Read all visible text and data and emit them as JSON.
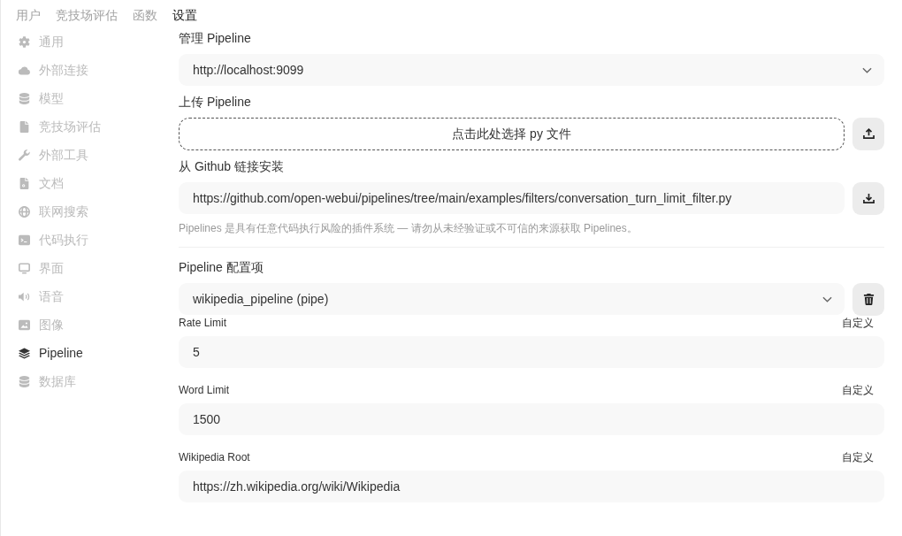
{
  "top_tabs": [
    {
      "label": "用户",
      "selected": false
    },
    {
      "label": "竞技场评估",
      "selected": false
    },
    {
      "label": "函数",
      "selected": false
    },
    {
      "label": "设置",
      "selected": true
    }
  ],
  "sidebar": {
    "items": [
      {
        "label": "通用",
        "selected": false
      },
      {
        "label": "外部连接",
        "selected": false
      },
      {
        "label": "模型",
        "selected": false
      },
      {
        "label": "竞技场评估",
        "selected": false
      },
      {
        "label": "外部工具",
        "selected": false
      },
      {
        "label": "文档",
        "selected": false
      },
      {
        "label": "联网搜索",
        "selected": false
      },
      {
        "label": "代码执行",
        "selected": false
      },
      {
        "label": "界面",
        "selected": false
      },
      {
        "label": "语音",
        "selected": false
      },
      {
        "label": "图像",
        "selected": false
      },
      {
        "label": "Pipeline",
        "selected": true
      },
      {
        "label": "数据库",
        "selected": false
      }
    ]
  },
  "manage_pipeline": {
    "label": "管理 Pipeline",
    "server_select": "http://localhost:9099"
  },
  "upload_pipeline": {
    "label": "上传 Pipeline",
    "dropzone": "点击此处选择 py 文件"
  },
  "github_install": {
    "label": "从 Github 链接安装",
    "url": "https://github.com/open-webui/pipelines/tree/main/examples/filters/conversation_turn_limit_filter.py",
    "warning": "Pipelines 是具有任意代码执行风险的插件系统 — 请勿从未经验证或不可信的来源获取 Pipelines。"
  },
  "pipeline_config": {
    "label": "Pipeline 配置项",
    "pipeline_select": "wikipedia_pipeline (pipe)",
    "valves": [
      {
        "name": "Rate Limit",
        "toggle": "自定义",
        "value": "5"
      },
      {
        "name": "Word Limit",
        "toggle": "自定义",
        "value": "1500"
      },
      {
        "name": "Wikipedia Root",
        "toggle": "自定义",
        "value": "https://zh.wikipedia.org/wiki/Wikipedia"
      }
    ]
  }
}
